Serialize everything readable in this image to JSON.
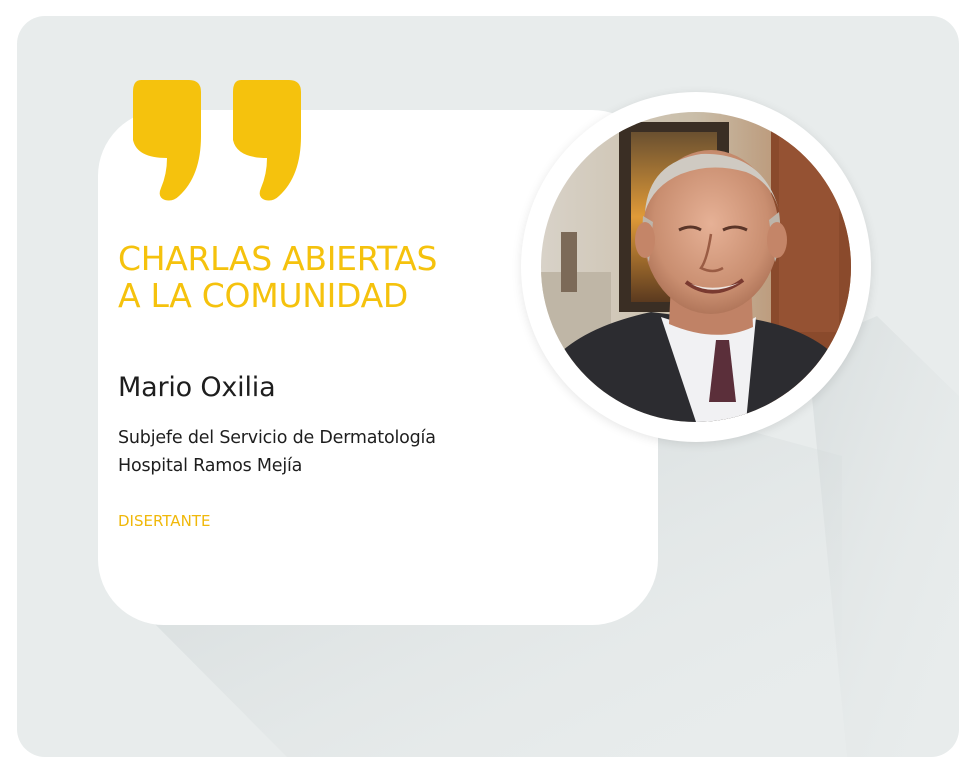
{
  "graphic": {
    "title_line1": "CHARLAS ABIERTAS",
    "title_line2": "A LA COMUNIDAD",
    "speaker": {
      "name": "Mario Oxilia",
      "role_line1": "Subjefe del Servicio de Dermatología",
      "role_line2": "Hospital Ramos Mejía",
      "tag": "DISERTANTE"
    },
    "photo": {
      "subject": "speaker-portrait"
    }
  },
  "colors": {
    "accent": "#f5c20d",
    "background": "#e8ecec",
    "card": "#ffffff",
    "text": "#1e1e1e"
  }
}
